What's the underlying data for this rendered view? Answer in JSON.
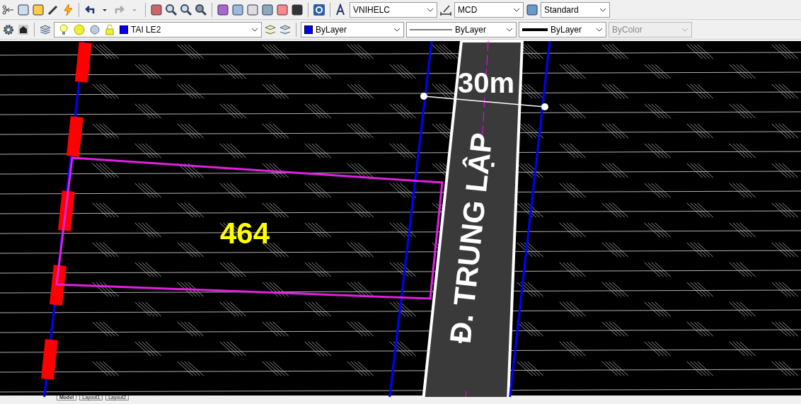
{
  "toolbar_top": {
    "text_style": "VNIHELC",
    "dim_style": "MCD",
    "table_style": "Standard"
  },
  "toolbar_layers": {
    "layer": "TAI LE2",
    "color_setting": "ByLayer",
    "linetype": "ByLayer",
    "lineweight": "ByLayer",
    "plot_style": {
      "value": "ByColor",
      "disabled": true
    }
  },
  "drawing": {
    "dimension": "30m",
    "parcel_number": "464",
    "road_name": "Đ. TRUNG LẬP"
  },
  "layout_tabs": [
    {
      "label": "Model",
      "selected": true
    },
    {
      "label": "Layout1",
      "selected": false
    },
    {
      "label": "Layout2",
      "selected": false
    }
  ]
}
